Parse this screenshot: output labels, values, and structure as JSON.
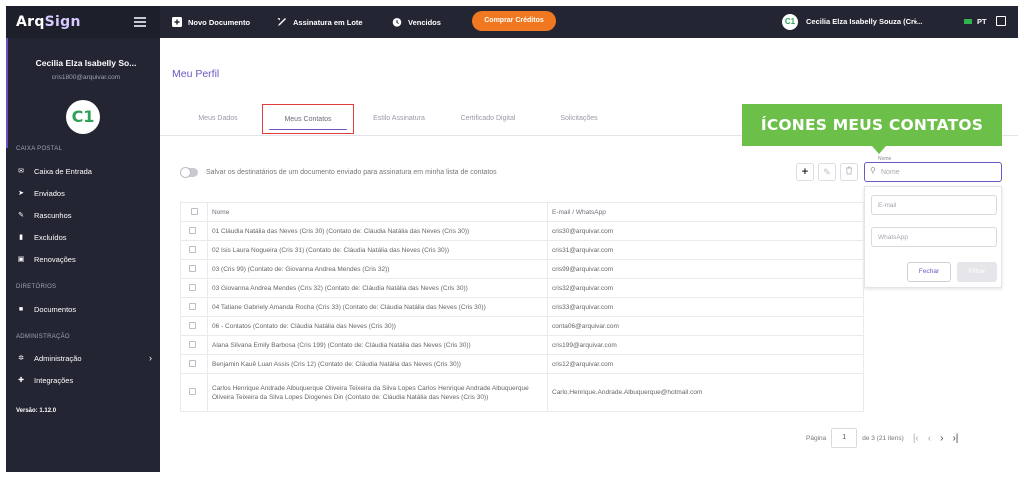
{
  "brand": {
    "logo_prefix": "Arq",
    "logo_suffix": "Sign"
  },
  "sidebar": {
    "user_name": "Cecilia Elza Isabelly So...",
    "user_email": "cris1800@arquivar.com",
    "avatar_initials": "C1",
    "sections": {
      "mailbox": "CAIXA POSTAL",
      "directories": "DIRETÓRIOS",
      "administration": "ADMINISTRAÇÃO"
    },
    "items": [
      {
        "label": "Caixa de Entrada",
        "icon": "inbox-icon"
      },
      {
        "label": "Enviados",
        "icon": "send-icon"
      },
      {
        "label": "Rascunhos",
        "icon": "pencil-icon"
      },
      {
        "label": "Excluídos",
        "icon": "trash-icon"
      },
      {
        "label": "Renovações",
        "icon": "calendar-icon"
      },
      {
        "label": "Documentos",
        "icon": "folder-icon"
      },
      {
        "label": "Administração",
        "icon": "gear-icon"
      },
      {
        "label": "Integrações",
        "icon": "puzzle-icon"
      }
    ],
    "version": "Versão: 1.12.0"
  },
  "topbar": {
    "new_document": "Novo Documento",
    "batch_signature": "Assinatura em Lote",
    "expired": "Vencidos",
    "buy_credits": "Comprar Créditos",
    "avatar_initials": "C1",
    "user_name": "Cecilia Elza Isabelly Souza (Cri...",
    "language": "PT"
  },
  "main": {
    "page_title": "Meu Perfil",
    "tabs": [
      {
        "label": "Meus Dados"
      },
      {
        "label": "Meus Contatos",
        "active": true
      },
      {
        "label": "Estilo Assinatura"
      },
      {
        "label": "Certificado Digital"
      },
      {
        "label": "Solicitações"
      }
    ],
    "callout": "ÍCONES MEUS CONTATOS",
    "toggle_label": "Salvar os destinatários de um documento enviado para assinatura em minha lista de contatos",
    "toolbar": {
      "add": "+",
      "edit": "✎",
      "delete": "🗑"
    },
    "filter": {
      "name_label": "Nome",
      "name_placeholder": "Nome",
      "email_placeholder": "E-mail",
      "whatsapp_placeholder": "WhatsApp",
      "close": "Fechar",
      "apply": "Filtrar"
    },
    "table": {
      "headers": {
        "name": "Nome",
        "email": "E-mail / WhatsApp"
      },
      "rows": [
        {
          "name": "01 Cláudia Natália das Neves (Cris 30) (Contato de: Cláudia Natália das Neves (Cris 30))",
          "email": "cris30@arquivar.com"
        },
        {
          "name": "02 Isis Laura Nogueira (Cris 31) (Contato de: Cláudia Natália das Neves (Cris 30))",
          "email": "cris31@arquivar.com"
        },
        {
          "name": "03 (Cris 99) (Contato de: Giovanna Andrea Mendes (Cris 32))",
          "email": "cris99@arquivar.com"
        },
        {
          "name": "03 Giovanna Andrea Mendes (Cris 32) (Contato de: Cláudia Natália das Neves (Cris 30))",
          "email": "cris32@arquivar.com"
        },
        {
          "name": "04 Tatiane Gabriely Amanda Rocha (Cris 33) (Contato de: Cláudia Natália das Neves (Cris 30))",
          "email": "cris33@arquivar.com"
        },
        {
          "name": "06 - Contatos (Contato de: Cláudia Natália das Neves (Cris 30))",
          "email": "conta06@arquivar.com"
        },
        {
          "name": "Alana Silvana Emily Barbosa (Cris 199) (Contato de: Cláudia Natália das Neves (Cris 30))",
          "email": "cris199@arquivar.com"
        },
        {
          "name": "Benjamin Kauê Luan Assis (Cris 12) (Contato de: Cláudia Natália das Neves (Cris 30))",
          "email": "cris12@arquivar.com"
        },
        {
          "name": "Carlos Henrique Andrade Albuquerque Oliveira Teixeira da Silva Lopes Carlos Henrique Andrade Albuquerque Oliveira Teixeira da Silva Lopes Diogenes Din (Contato de: Cláudia Natália das Neves (Cris 30))",
          "email": "Carlo.Henrique.Andrade.Albuquerque@hotmail.com"
        }
      ]
    },
    "pagination": {
      "page_label": "Página",
      "current_page": "1",
      "of_text": "de 3 (21 itens)"
    }
  }
}
